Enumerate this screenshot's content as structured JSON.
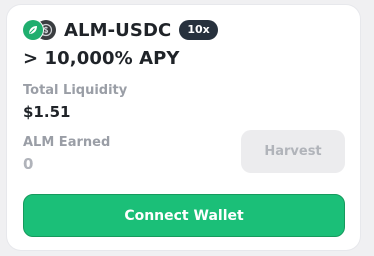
{
  "farm_card": {
    "pair_name": "ALM-USDC",
    "multiplier": "10x",
    "tokens": [
      {
        "symbol": "ALM",
        "icon": "leaf-icon",
        "color": "#1fae6e"
      },
      {
        "symbol": "USDC",
        "icon": "dollar-coin-icon",
        "color": "#3a3d40"
      }
    ],
    "apy": "> 10,000% APY",
    "total_liquidity_label": "Total Liquidity",
    "total_liquidity_value": "$1.51",
    "earned_label": "ALM Earned",
    "earned_value": "0",
    "harvest_label": "Harvest",
    "connect_wallet_label": "Connect Wallet"
  },
  "colors": {
    "accent_green": "#1bbf78",
    "dark_badge": "#27313d",
    "muted_text": "#9a9ea6"
  }
}
